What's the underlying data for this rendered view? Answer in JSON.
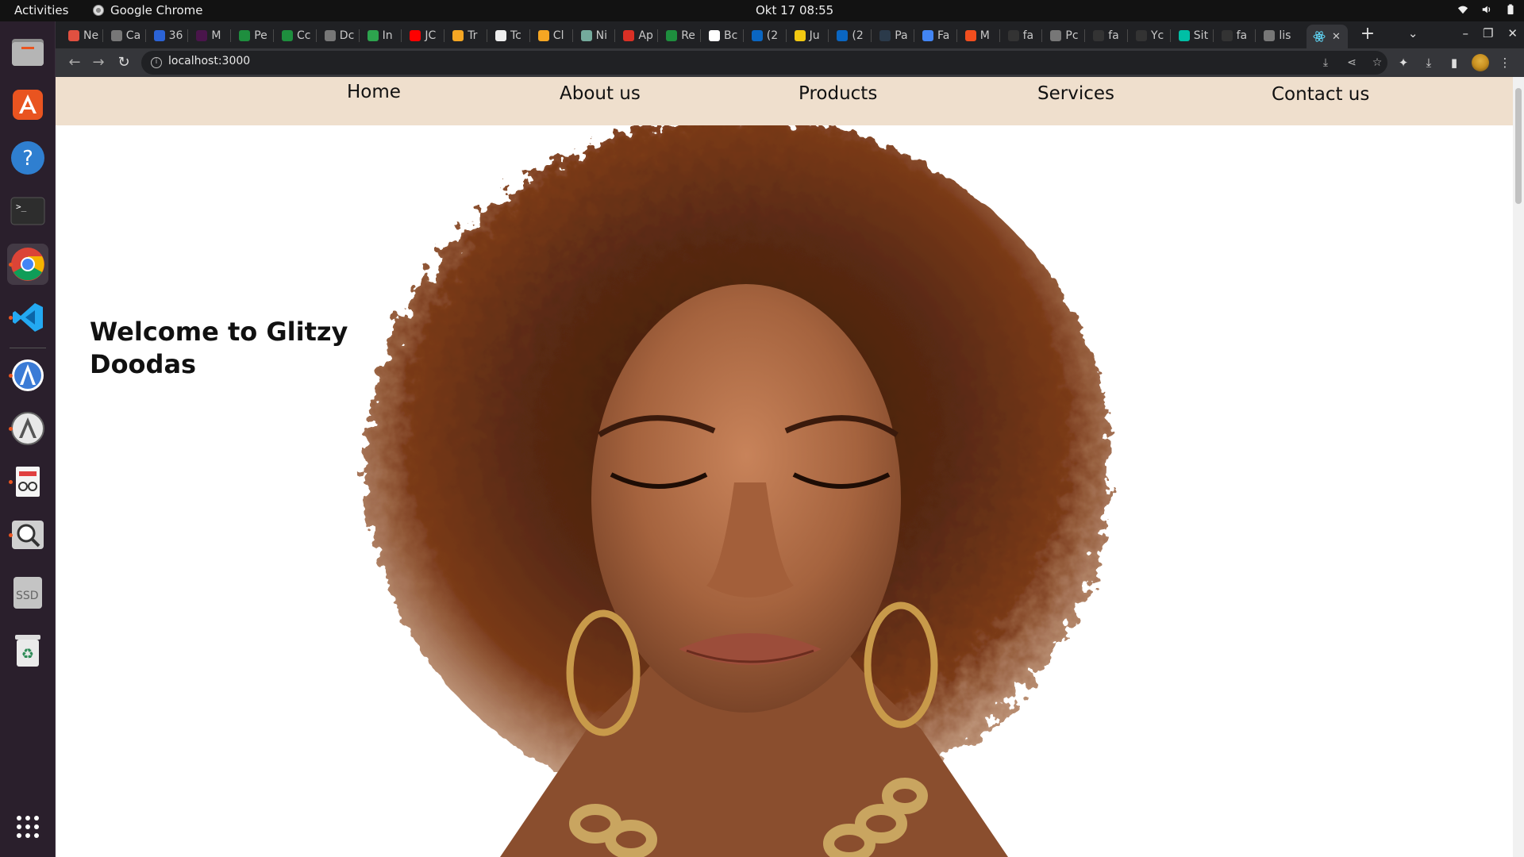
{
  "system": {
    "activities_label": "Activities",
    "app_name": "Google Chrome",
    "clock": "Okt 17  08:55"
  },
  "tabs": [
    {
      "label": "Ne",
      "icon": "notion-icon",
      "color": "#e05040"
    },
    {
      "label": "Ca",
      "icon": "globe-icon",
      "color": "#777777"
    },
    {
      "label": "36",
      "icon": "blue-icon",
      "color": "#2b63d6"
    },
    {
      "label": "M",
      "icon": "slack-icon",
      "color": "#4a154b"
    },
    {
      "label": "Pe",
      "icon": "sheets-icon",
      "color": "#1e8e3e"
    },
    {
      "label": "Cc",
      "icon": "sheets-icon",
      "color": "#1e8e3e"
    },
    {
      "label": "Dc",
      "icon": "globe-icon",
      "color": "#777777"
    },
    {
      "label": "In",
      "icon": "cloud-icon",
      "color": "#2da44e"
    },
    {
      "label": "JC",
      "icon": "youtube-icon",
      "color": "#ff0000"
    },
    {
      "label": "Tr",
      "icon": "firebase-icon",
      "color": "#f5a623"
    },
    {
      "label": "Tc",
      "icon": "circle-icon",
      "color": "#eeeeee"
    },
    {
      "label": "Cl",
      "icon": "firebase-icon",
      "color": "#f5a623"
    },
    {
      "label": "Ni",
      "icon": "openai-icon",
      "color": "#74aa9c"
    },
    {
      "label": "Ap",
      "icon": "gmail-icon",
      "color": "#d93025"
    },
    {
      "label": "Re",
      "icon": "sheets-icon",
      "color": "#1e8e3e"
    },
    {
      "label": "Bc",
      "icon": "w-icon",
      "color": "#ffffff"
    },
    {
      "label": "(2",
      "icon": "linkedin-icon",
      "color": "#0a66c2"
    },
    {
      "label": "Ju",
      "icon": "warning-icon",
      "color": "#f2c811"
    },
    {
      "label": "(2",
      "icon": "linkedin-icon",
      "color": "#0a66c2"
    },
    {
      "label": "Pa",
      "icon": "dark-icon",
      "color": "#2b3a4a"
    },
    {
      "label": "Fa",
      "icon": "docs-icon",
      "color": "#4285f4"
    },
    {
      "label": "M",
      "icon": "figma-icon",
      "color": "#f24e1e"
    },
    {
      "label": "fa",
      "icon": "github-icon",
      "color": "#333333"
    },
    {
      "label": "Pc",
      "icon": "globe-icon",
      "color": "#777777"
    },
    {
      "label": "fa",
      "icon": "github-icon",
      "color": "#333333"
    },
    {
      "label": "Yc",
      "icon": "github-icon",
      "color": "#333333"
    },
    {
      "label": "Sit",
      "icon": "diamond-icon",
      "color": "#00bfa5"
    },
    {
      "label": "fa",
      "icon": "github-icon",
      "color": "#333333"
    },
    {
      "label": "lis",
      "icon": "globe-icon",
      "color": "#777777"
    }
  ],
  "active_tab": {
    "icon": "react-icon",
    "close": "✕"
  },
  "address_bar": {
    "url": "localhost:3000"
  },
  "site": {
    "nav": [
      "Home",
      "About us",
      "Products",
      "Services",
      "Contact us"
    ],
    "hero_title": "Welcome to Glitzy Doodas",
    "hero_image": "portrait-woman-afro-hoop-earrings",
    "nav_bg": "#efdfcd"
  },
  "dock": [
    {
      "name": "files-app-icon",
      "color": "#8a8a8a"
    },
    {
      "name": "ubuntu-software-icon",
      "color": "#e95420"
    },
    {
      "name": "help-icon",
      "color": "#2f7fd0"
    },
    {
      "name": "terminal-icon",
      "color": "#2d2d2d"
    },
    {
      "name": "chrome-icon",
      "color": "#ffffff"
    },
    {
      "name": "vscode-icon",
      "color": "#23a9f2"
    },
    {
      "name": "android-studio-icon",
      "color": "#3b7bd6"
    },
    {
      "name": "software-updater-icon",
      "color": "#888888"
    },
    {
      "name": "document-viewer-icon",
      "color": "#e04040"
    },
    {
      "name": "search-app-icon",
      "color": "#cccccc"
    },
    {
      "name": "ssd-drive-icon",
      "color": "#bbbbbb"
    },
    {
      "name": "trash-icon",
      "color": "#2e8b57"
    }
  ],
  "dock_ssd_label": "SSD"
}
